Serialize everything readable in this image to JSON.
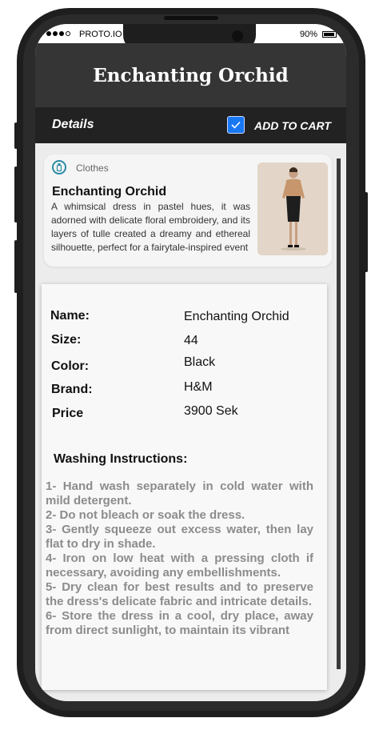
{
  "status_bar": {
    "carrier": "PROTO.IO",
    "battery": "90%"
  },
  "header": {
    "title": "Enchanting Orchid"
  },
  "toolbar": {
    "details": "Details",
    "add_to_cart": "ADD TO CART",
    "checked": true
  },
  "product": {
    "category": "Clothes",
    "category_icon": "bottle-icon",
    "name": "Enchanting Orchid",
    "description": "A whimsical dress in pastel hues, it was adorned with delicate floral embroidery, and its layers of tulle created a dreamy and ethereal silhouette, perfect for a fairytale-inspired event"
  },
  "info": {
    "name_label": "Name:",
    "name_value": "Enchanting Orchid",
    "size_label": "Size:",
    "size_value": "44",
    "color_label": "Color:",
    "color_value": "Black",
    "brand_label": "Brand:",
    "brand_value": "H&M",
    "price_label": "Price",
    "price_value": "3900 Sek"
  },
  "washing": {
    "title": "Washing Instructions:",
    "text": "1- Hand wash separately in cold water with mild detergent.\n2- Do not bleach or soak the dress.\n3- Gently squeeze out excess water, then lay flat to dry in shade.\n4- Iron on low heat with a pressing cloth if necessary, avoiding any embellishments.\n5- Dry clean for best results and to preserve the dress's delicate fabric and intricate details.\n6- Store the dress in a cool, dry place, away from direct sunlight, to maintain its vibrant"
  },
  "colors": {
    "accent": "#1877f2",
    "header_bg": "#353535",
    "toolbar_bg": "#222222"
  }
}
